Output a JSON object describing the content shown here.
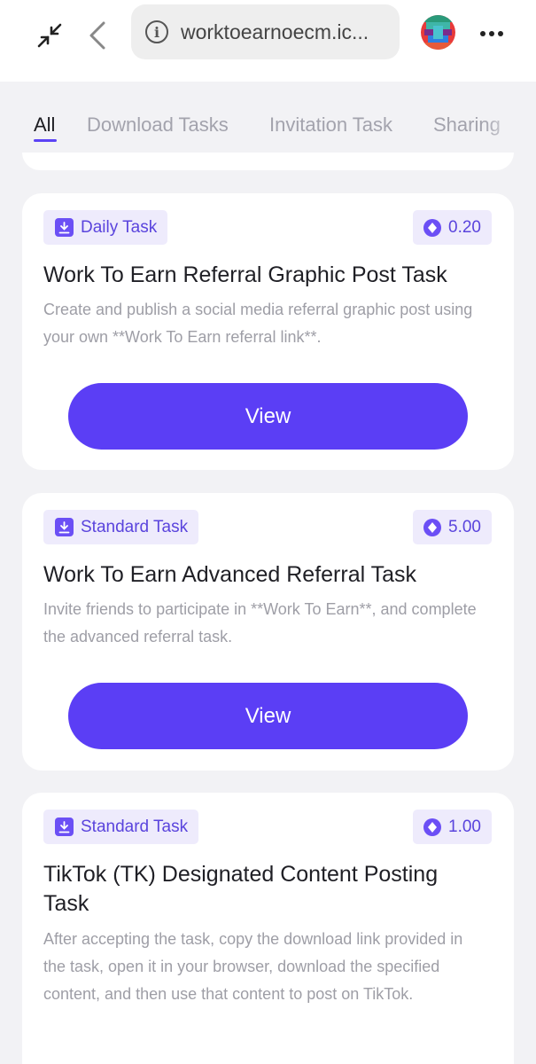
{
  "browser": {
    "url": "worktoearnoecm.ic...",
    "icons": [
      "minimize-icon",
      "back-icon",
      "info-icon",
      "avatar",
      "more-icon"
    ]
  },
  "tabs": [
    {
      "label": "All",
      "active": true
    },
    {
      "label": "Download Tasks",
      "active": false
    },
    {
      "label": "Invitation Task",
      "active": false
    },
    {
      "label": "Sharing",
      "active": false
    }
  ],
  "colors": {
    "accent": "#5b3ef5",
    "badge_bg": "#eeebfc",
    "badge_text": "#5a44dd"
  },
  "tasks": [
    {
      "badge": "Daily Task",
      "reward": "0.20",
      "title": "Work To Earn Referral Graphic Post Task",
      "description": "Create and publish a social media referral graphic post using your own **Work To Earn referral link**.",
      "button": "View"
    },
    {
      "badge": "Standard Task",
      "reward": "5.00",
      "title": "Work To Earn Advanced Referral Task",
      "description": "Invite friends to participate in **Work To Earn**, and complete the advanced referral task.",
      "button": "View"
    },
    {
      "badge": "Standard Task",
      "reward": "1.00",
      "title": "TikTok (TK) Designated Content Posting Task",
      "description": "After accepting the task, copy the download link provided in the task, open it in your browser, download the specified content, and then use that content to post on TikTok."
    }
  ]
}
